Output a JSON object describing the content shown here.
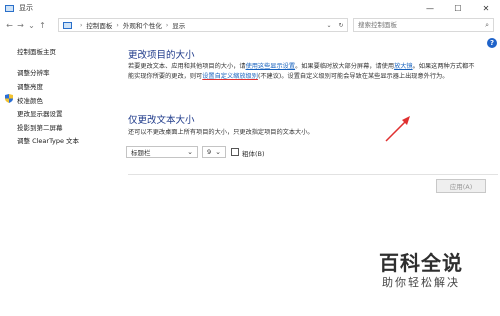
{
  "window": {
    "title": "显示",
    "minimize": "—",
    "maximize": "☐",
    "close": "✕"
  },
  "address": {
    "crumbs": [
      "控制面板",
      "外观和个性化",
      "显示"
    ],
    "search_placeholder": "搜索控制面板"
  },
  "sidebar": {
    "home": "控制面板主页",
    "links": [
      "调整分辨率",
      "调整亮度",
      "校准颜色",
      "更改显示器设置",
      "投影到第二屏幕",
      "调整 ClearType 文本"
    ]
  },
  "main": {
    "heading1": "更改项目的大小",
    "para1_part1": "若要更改文本、应用和其他项目的大小，请",
    "para1_link1": "使用这些显示设置",
    "para1_part2": "。如果要临时放大部分屏幕，请使用",
    "para1_link2": "放大镜",
    "para1_part3": "。如果这两种方式都不能实现你所要的更改，则可",
    "para1_link3": "设置自定义缩放级别",
    "para1_part4": "(不建议)。设置自定义级别可能会导致在某些显示器上出现意外行为。",
    "heading2": "仅更改文本大小",
    "para2": "还可以不更改桌面上所有项目的大小，只更改指定项目的文本大小。",
    "item_select": "标题栏",
    "size_select": "9",
    "bold_label": "粗体(B)",
    "apply_label": "应用(A)"
  },
  "watermark": {
    "logo": "百科全说",
    "sub": "助你轻松解决"
  },
  "colors": {
    "heading": "#1e3a8a",
    "link": "#1560bd",
    "arrow": "#e03030"
  }
}
